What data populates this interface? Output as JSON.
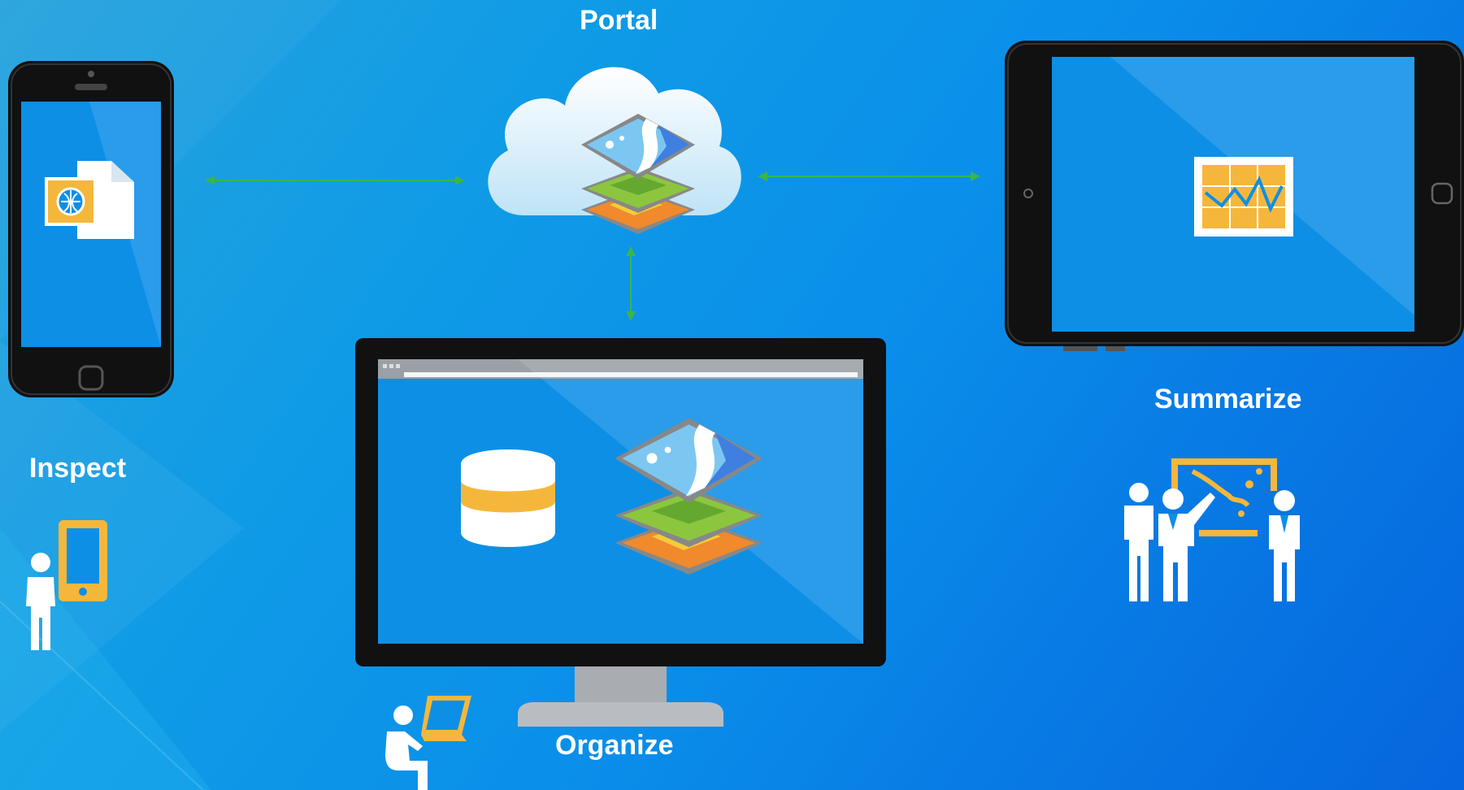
{
  "labels": {
    "portal": "Portal",
    "inspect": "Inspect",
    "organize": "Organize",
    "summarize": "Summarize"
  },
  "colors": {
    "background_start": "#27a3dc",
    "background_end": "#0566dd",
    "screen_blue": "#0d8fe6",
    "accent_yellow": "#f5b73b",
    "connector_green": "#3bb54a",
    "device_black": "#111111"
  },
  "icons": {
    "phone_app": "document-with-map-icon",
    "cloud_layers": "map-layers-icon",
    "tablet_app": "dashboard-chart-icon",
    "monitor_db": "database-icon",
    "monitor_layers": "map-layers-icon",
    "inspect_person": "person-with-phone-icon",
    "organize_person": "person-at-laptop-icon",
    "summarize_people": "group-presenting-map-icon"
  }
}
